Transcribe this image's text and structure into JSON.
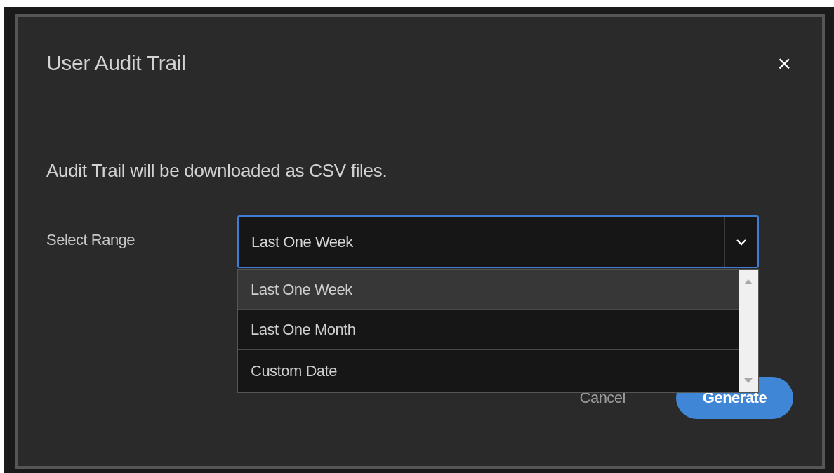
{
  "dialog": {
    "title": "User Audit Trail",
    "close_icon": "×",
    "message": "Audit Trail will be downloaded as CSV files.",
    "range": {
      "label": "Select Range",
      "value": "Last One Week",
      "expanded": true,
      "options": [
        {
          "label": "Last One Week",
          "selected": true
        },
        {
          "label": "Last One Month",
          "selected": false
        },
        {
          "label": "Custom Date",
          "selected": false
        }
      ]
    },
    "buttons": [
      {
        "kind": "secondary",
        "label": "Cancel"
      },
      {
        "kind": "primary",
        "label": "Generate"
      }
    ]
  }
}
